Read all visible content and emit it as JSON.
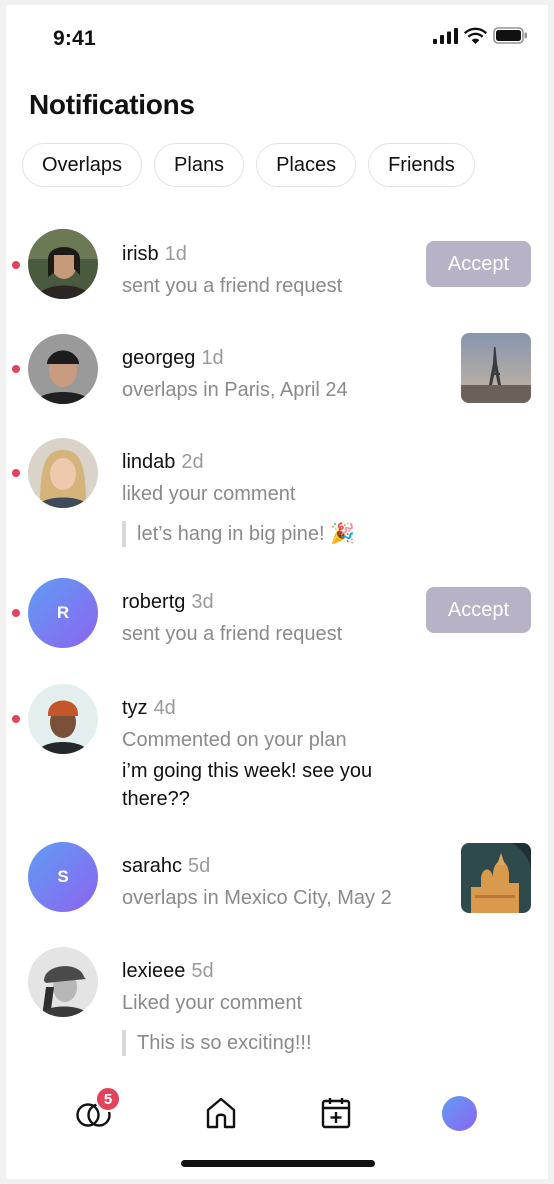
{
  "status_bar": {
    "time": "9:41"
  },
  "page": {
    "title": "Notifications"
  },
  "filters": [
    "Overlaps",
    "Plans",
    "Places",
    "Friends"
  ],
  "notifications": [
    {
      "user": "irisb",
      "age": "1d",
      "action": "sent you a friend request",
      "button": "Accept",
      "unread": true,
      "avatar_icon": "photo-avatar"
    },
    {
      "user": "georgeg",
      "age": "1d",
      "action": "overlaps in Paris, April 24",
      "unread": true,
      "thumbnail": "eiffel-tower-photo"
    },
    {
      "user": "lindab",
      "age": "2d",
      "action": "liked your comment",
      "quote": "let’s hang in big pine! 🎉",
      "unread": true
    },
    {
      "user": "robertg",
      "age": "3d",
      "action": "sent you a friend request",
      "button": "Accept",
      "unread": true,
      "initial": "R"
    },
    {
      "user": "tyz",
      "age": "4d",
      "action": "Commented on your plan",
      "comment": "i’m going this week! see you there??",
      "unread": true
    },
    {
      "user": "sarahc",
      "age": "5d",
      "action": "overlaps in Mexico City, May 2",
      "unread": false,
      "initial": "S",
      "thumbnail": "basilica-photo"
    },
    {
      "user": "lexieee",
      "age": "5d",
      "action": "Liked your comment",
      "quote": "This is so exciting!!!",
      "unread": false
    }
  ],
  "tab_bar": {
    "badge_count": "5",
    "tabs": [
      "overlaps-icon",
      "home-icon",
      "calendar-add-icon",
      "profile-avatar"
    ]
  },
  "colors": {
    "accent_dot": "#e0435b",
    "accept_button": "#b8b2c6",
    "avatar_gradient_start": "#5f9df5",
    "avatar_gradient_end": "#8d63ef"
  }
}
